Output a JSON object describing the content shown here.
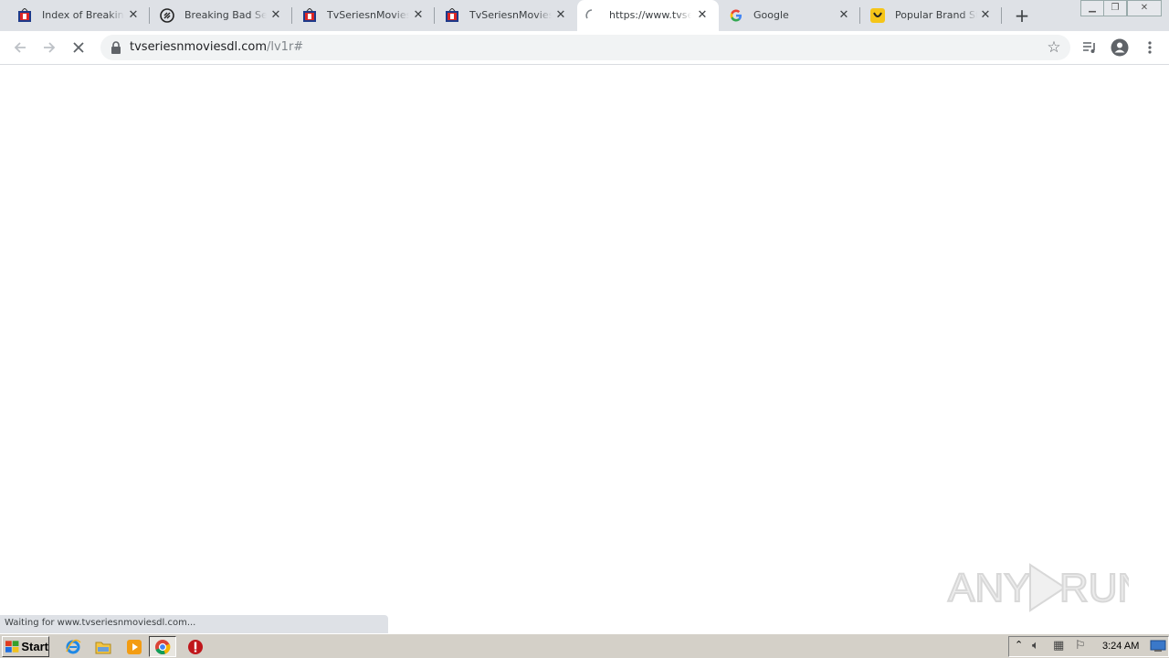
{
  "tabs": [
    {
      "title": "Index of Breaking Bad",
      "favicon": "tv-favicon-icon",
      "active": false
    },
    {
      "title": "Breaking Bad Season",
      "favicon": "shield-favicon-icon",
      "active": false
    },
    {
      "title": "TvSeriesnMoviesDL",
      "favicon": "tv-favicon-icon",
      "active": false
    },
    {
      "title": "TvSeriesnMoviesDL",
      "favicon": "tv-favicon-icon",
      "active": false
    },
    {
      "title": "https://www.tvseriesnmoviesdl.com",
      "favicon": "loading-spinner-icon",
      "active": true
    },
    {
      "title": "Google",
      "favicon": "google-favicon-icon",
      "active": false
    },
    {
      "title": "Popular Brand Store",
      "favicon": "brand-favicon-icon",
      "active": false
    }
  ],
  "omnibox": {
    "host": "tvseriesnmoviesdl.com",
    "path": "/lv1r#"
  },
  "status_text": "Waiting for www.tvseriesnmoviesdl.com...",
  "watermark": "ANY RUN",
  "taskbar": {
    "start_label": "Start",
    "clock": "3:24 AM"
  },
  "colors": {
    "tab_strip": "#dee1e6",
    "taskbar": "#d4d0c8",
    "accent_blue": "#1a73e8"
  }
}
